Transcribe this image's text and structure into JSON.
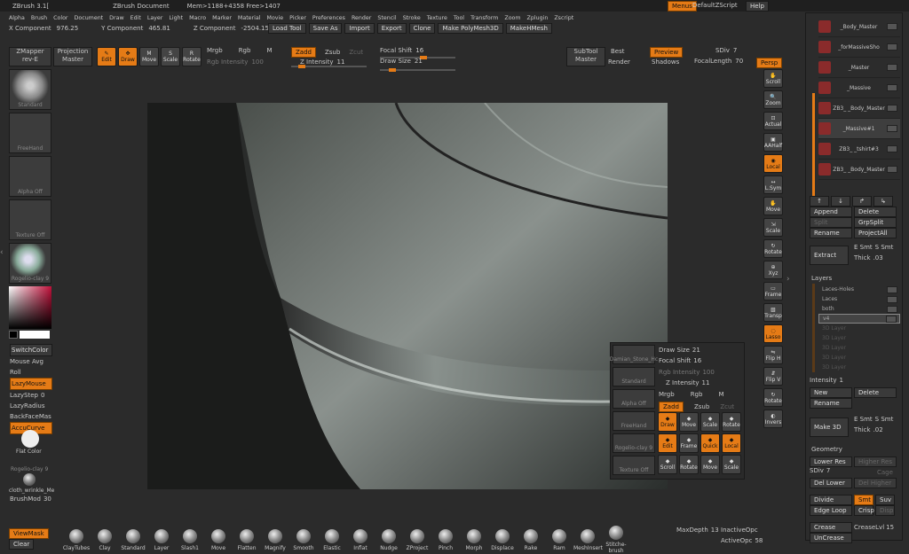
{
  "title_bar": {
    "app": "ZBrush 3.1[",
    "doc": "ZBrush Document",
    "mem": "Mem>1188+4358 Free>1407",
    "menus_btn": "Menus",
    "script": "DefaultZScript",
    "help": "Help"
  },
  "menu": [
    "Alpha",
    "Brush",
    "Color",
    "Document",
    "Draw",
    "Edit",
    "Layer",
    "Light",
    "Macro",
    "Marker",
    "Material",
    "Movie",
    "Picker",
    "Preferences",
    "Render",
    "Stencil",
    "Stroke",
    "Texture",
    "Tool",
    "Transform",
    "Zoom",
    "Zplugin",
    "Zscript"
  ],
  "coords": {
    "x_label": "X Component",
    "x_val": "976.25",
    "y_label": "Y Component",
    "y_val": "465.81",
    "z_label": "Z Component",
    "z_val": "-2504.15"
  },
  "file_btns": [
    "Load Tool",
    "Save As",
    "Import",
    "Export",
    "Clone",
    "Make PolyMesh3D",
    "MakeHMesh"
  ],
  "top": {
    "zmapper": "ZMapper",
    "zmapper_sub": "rev-E",
    "projection": "Projection",
    "projection_sub": "Master",
    "edit": "Edit",
    "draw": "Draw",
    "move": "Move",
    "scale": "Scale",
    "rotate": "Rotate",
    "mrgb": "Mrgb",
    "rgb": "Rgb",
    "m": "M",
    "rgb_int": "Rgb Intensity",
    "rgb_int_val": "100",
    "zadd": "Zadd",
    "zsub": "Zsub",
    "zcut": "Zcut",
    "zint": "Z Intensity",
    "zint_val": "11",
    "focal": "Focal Shift",
    "focal_val": "16",
    "drawsize": "Draw Size",
    "drawsize_val": "21",
    "subtool": "SubTool",
    "subtool_sub": "Master",
    "best": "Best",
    "render": "Render",
    "preview": "Preview",
    "shadows": "Shadows",
    "sdiv": "SDiv",
    "sdiv_val": "7",
    "focal_len": "FocalLength",
    "focal_len_val": "70",
    "persp": "Persp"
  },
  "left": {
    "tiles": [
      "Standard",
      "FreeHand",
      "Alpha Off",
      "Texture Off",
      "Rogelio-clay 9"
    ],
    "switch_color": "SwitchColor",
    "mouse_avg": "Mouse Avg",
    "roll": "Roll",
    "lazymouse": "LazyMouse",
    "lazystep": "LazyStep",
    "lazystep_val": "0",
    "lazyradius": "LazyRadius",
    "backface": "BackFaceMas",
    "accucurve": "AccuCurve",
    "flat_color": "Flat Color",
    "rogelio": "Rogelio-clay 9",
    "cloth": "cloth_wrinkle_Me",
    "brushmod": "BrushMod",
    "brushmod_val": "30",
    "viewmask": "ViewMask",
    "clear": "Clear"
  },
  "right_tools": [
    "Scroll",
    "Zoom",
    "Actual",
    "AAHalf",
    "Local",
    "L.Sym",
    "Move",
    "Scale",
    "Rotate",
    "Xyz",
    "Frame",
    "Transp",
    "Lasso",
    "Flip H",
    "Flip V",
    "Rotate",
    "Invers"
  ],
  "subtools": [
    {
      "name": "_Body_Master"
    },
    {
      "name": "_forMassiveSho"
    },
    {
      "name": "_Master"
    },
    {
      "name": "_Massive"
    },
    {
      "name": "ZB3_ _Body_Master"
    },
    {
      "name": "_Massive#1"
    },
    {
      "name": "ZB3_ _tshirt#3"
    },
    {
      "name": "ZB3_ _Body_Master"
    }
  ],
  "st_btns": {
    "append": "Append",
    "delete": "Delete",
    "split": "Split",
    "grpsplit": "GrpSplit",
    "rename": "Rename",
    "projectall": "ProjectAll",
    "extract": "Extract",
    "esmt": "E Smt",
    "ssmt": "S Smt",
    "thick": "Thick",
    "thick_val": ".03"
  },
  "layers": {
    "title": "Layers",
    "items": [
      "Laces-Holes",
      "Laces",
      "both",
      "v4"
    ],
    "disabled": [
      "3D Layer",
      "3D Layer",
      "3D Layer",
      "3D Layer",
      "3D Layer"
    ],
    "intensity": "Intensity",
    "intensity_val": "1",
    "new": "New",
    "delete": "Delete",
    "rename": "Rename",
    "make3d": "Make 3D",
    "esmt": "E Smt",
    "ssmt": "S Smt",
    "thick": "Thick",
    "thick_val": ".02"
  },
  "geometry": {
    "title": "Geometry",
    "lower": "Lower Res",
    "higher": "Higher Res",
    "sdiv": "SDiv",
    "sdiv_val": "7",
    "cage": "Cage",
    "del_lower": "Del Lower",
    "del_higher": "Del Higher",
    "divide": "Divide",
    "smt": "Smt",
    "suv": "Suv",
    "edgeloop": "Edge Loop",
    "crisp": "Crisp",
    "disp": "Disp",
    "crease": "Crease",
    "creaselvl": "CreaseLvl",
    "creaselvl_val": "15",
    "uncrease": "UnCrease"
  },
  "popup": {
    "drawsize": "Draw Size",
    "drawsize_val": "21",
    "focal": "Focal Shift",
    "focal_val": "16",
    "rgbint": "Rgb Intensity",
    "rgbint_val": "100",
    "zint": "Z Intensity",
    "zint_val": "11",
    "mrgb": "Mrgb",
    "rgb": "Rgb",
    "m": "M",
    "zadd": "Zadd",
    "zsub": "Zsub",
    "zcut": "Zcut",
    "tiles": [
      "Damian_Stone_Hc",
      "Standard",
      "Alpha Off",
      "FreeHand",
      "Rogelio-clay 9",
      "Texture Off"
    ],
    "btns": [
      "Draw",
      "Move",
      "Scale",
      "Rotate",
      "Edit",
      "Frame",
      "Quick",
      "Local",
      "Scroll",
      "Rotate",
      "Move",
      "Scale"
    ]
  },
  "brushes": [
    "ClayTubes",
    "Clay",
    "Standard",
    "Layer",
    "Slash1",
    "Move",
    "Flatten",
    "Magnify",
    "Smooth",
    "Elastic",
    "Inflat",
    "Nudge",
    "ZProject",
    "Pinch",
    "Morph",
    "Displace",
    "Rake",
    "Ram",
    "MeshInsert",
    "Stitche-brush"
  ],
  "bottom": {
    "maxdepth": "MaxDepth",
    "maxdepth_val": "13",
    "inactive": "InactiveOpc",
    "activeopc": "ActiveOpc",
    "activeopc_val": "58"
  },
  "colors": {
    "accent": "#e57b16",
    "bg": "#2b2b2b"
  }
}
